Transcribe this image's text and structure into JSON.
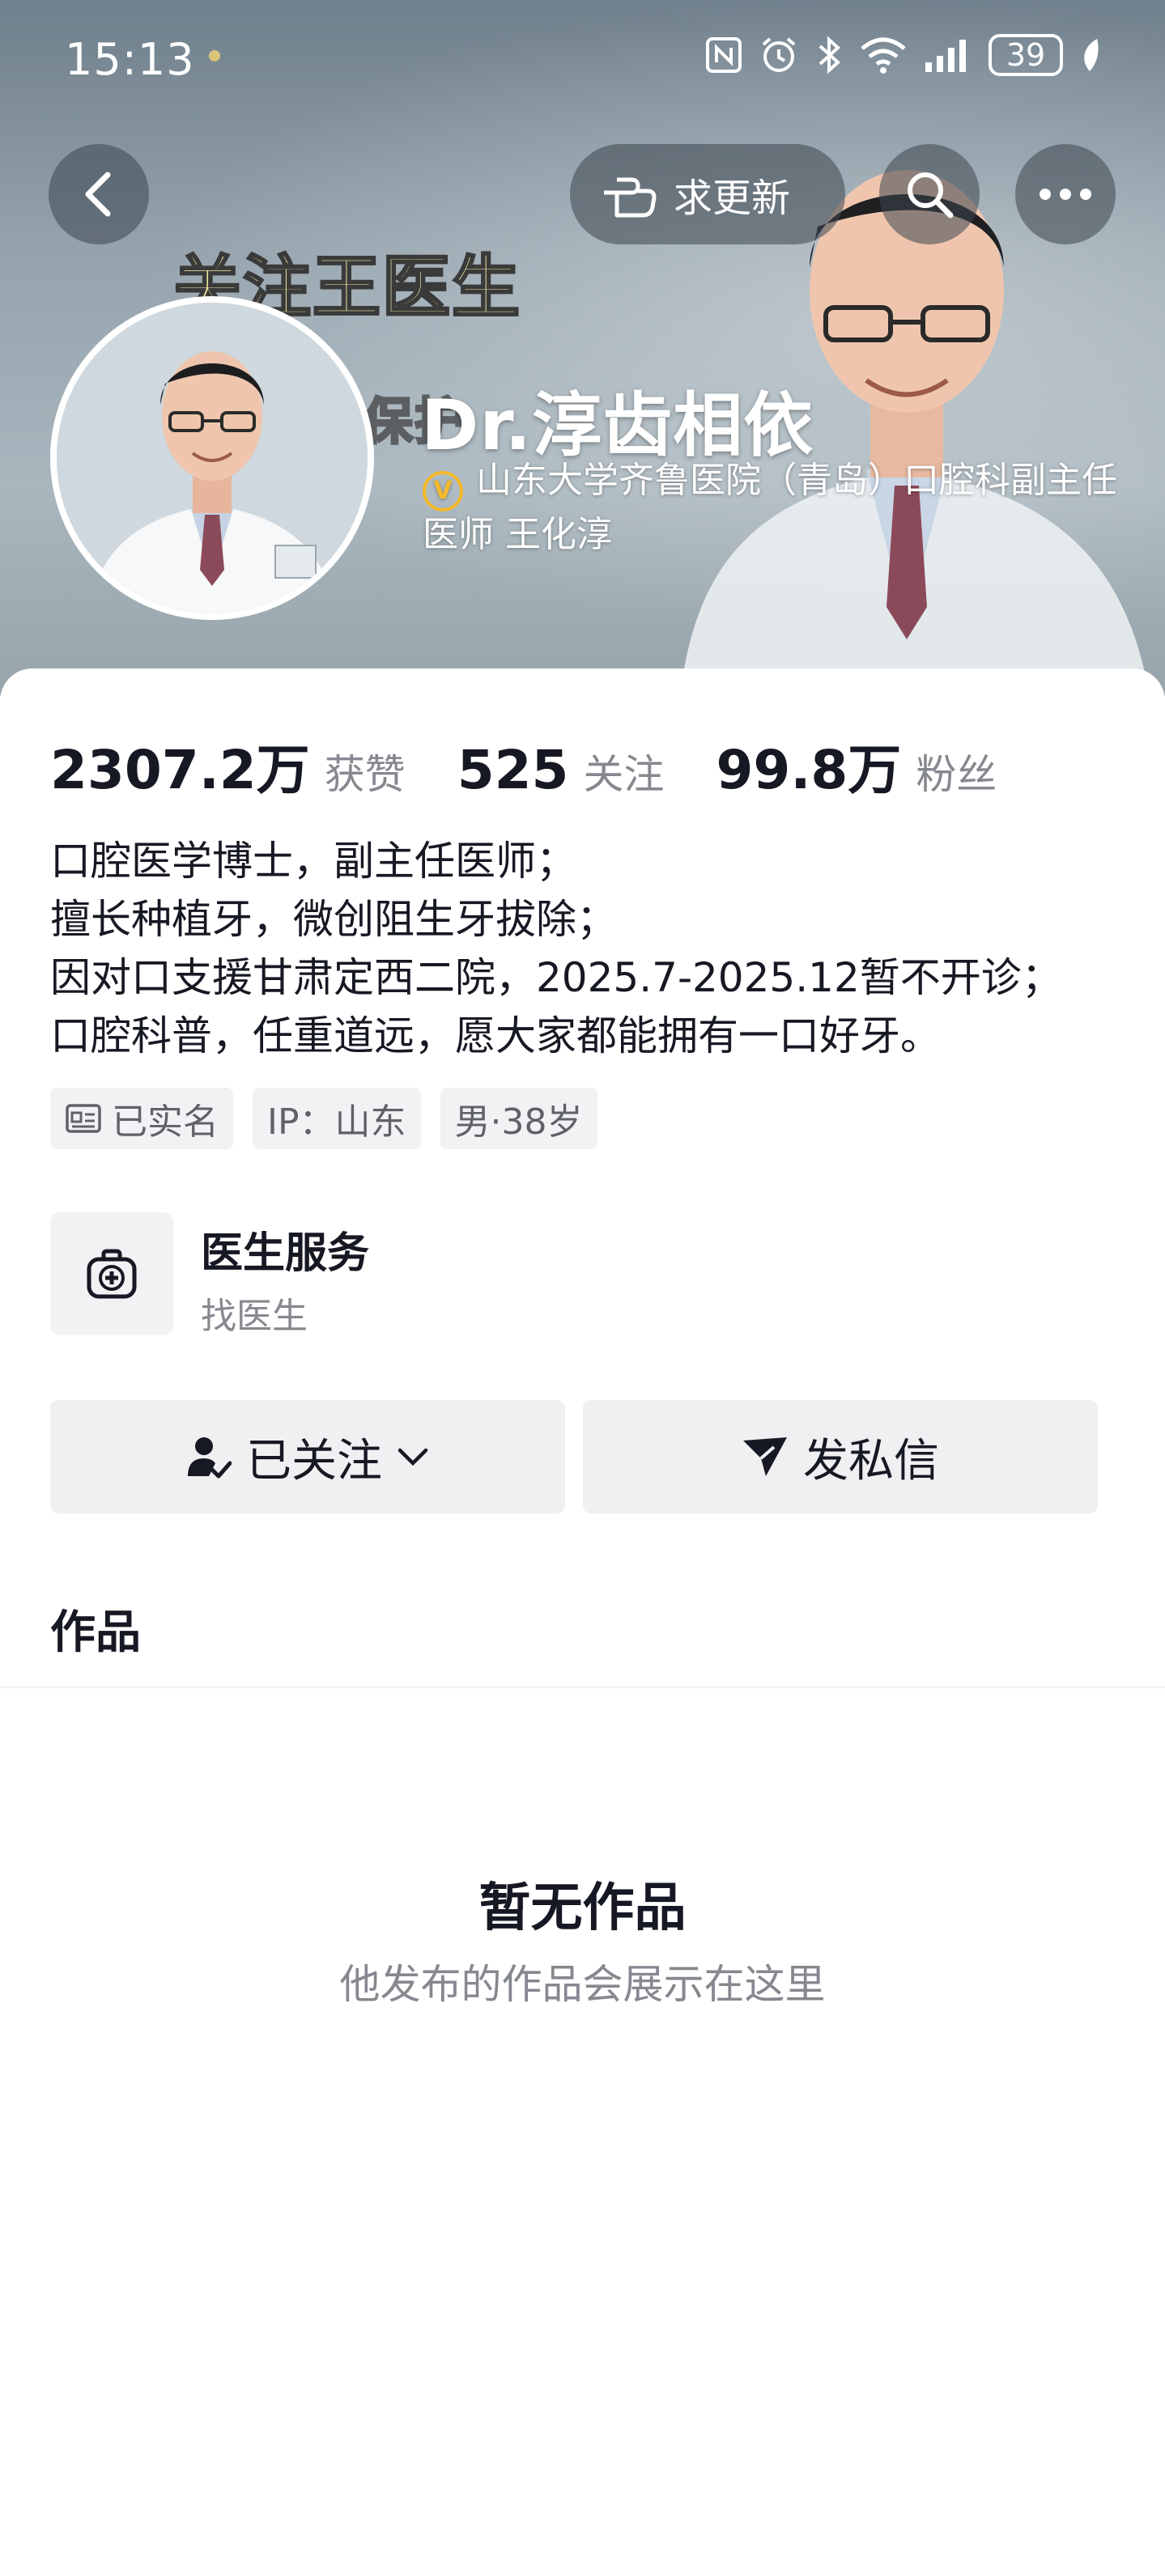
{
  "status_bar": {
    "time": "15:13",
    "icons": [
      "nfc-icon",
      "alarm-icon",
      "bluetooth-icon",
      "wifi-icon",
      "signal-icon"
    ],
    "battery": "39"
  },
  "header": {
    "back_icon": "chevron-left-icon",
    "request_update_label": "求更新",
    "search_icon": "search-icon",
    "more_icon": "more-dots-icon",
    "banner_overlay_text": "关注王医生",
    "banner_overlay_text_2": "保护"
  },
  "profile": {
    "nickname": "Dr.淳齿相依",
    "verification": "山东大学齐鲁医院（青岛）口腔科副主任医师 王化淳",
    "verify_badge": "V",
    "verify_color": "#f3b92a"
  },
  "stats": [
    {
      "value": "2307.2万",
      "label": "获赞"
    },
    {
      "value": "525",
      "label": "关注"
    },
    {
      "value": "99.8万",
      "label": "粉丝"
    }
  ],
  "bio": {
    "lines": [
      "口腔医学博士，副主任医师；",
      "擅长种植牙，微创阻生牙拔除；",
      "因对口支援甘肃定西二院，2025.7-2025.12暂不开诊；",
      "口腔科普，任重道远，愿大家都能拥有一口好牙。"
    ]
  },
  "tags": {
    "real_name": "已实名",
    "ip": "IP：山东",
    "gender_age": "男·38岁"
  },
  "service": {
    "title": "医生服务",
    "subtitle": "找医生"
  },
  "actions": {
    "following": "已关注",
    "message": "发私信"
  },
  "tabs": {
    "works": "作品"
  },
  "empty_state": {
    "title": "暂无作品",
    "subtitle": "他发布的作品会展示在这里"
  }
}
